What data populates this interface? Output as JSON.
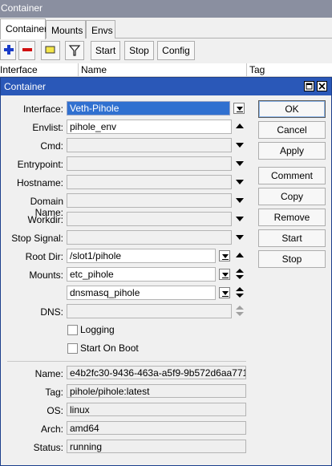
{
  "window": {
    "title": "Container"
  },
  "tabs": [
    "Container",
    "Mounts",
    "Envs"
  ],
  "toolbar": {
    "start": "Start",
    "stop": "Stop",
    "config": "Config"
  },
  "columns": {
    "interface": "Interface",
    "name": "Name",
    "tag": "Tag"
  },
  "dialog": {
    "title": "Container",
    "fields": {
      "interface": {
        "label": "Interface:",
        "value": "Veth-Pihole"
      },
      "envlist": {
        "label": "Envlist:",
        "value": "pihole_env"
      },
      "cmd": {
        "label": "Cmd:",
        "value": ""
      },
      "entrypoint": {
        "label": "Entrypoint:",
        "value": ""
      },
      "hostname": {
        "label": "Hostname:",
        "value": ""
      },
      "domain_name": {
        "label": "Domain Name:",
        "value": ""
      },
      "workdir": {
        "label": "Workdir:",
        "value": ""
      },
      "stop_signal": {
        "label": "Stop Signal:",
        "value": ""
      },
      "root_dir": {
        "label": "Root Dir:",
        "value": "/slot1/pihole"
      },
      "mounts": {
        "label": "Mounts:",
        "values": [
          "etc_pihole",
          "dnsmasq_pihole"
        ]
      },
      "dns": {
        "label": "DNS:",
        "value": ""
      }
    },
    "checkboxes": {
      "logging": {
        "label": "Logging",
        "checked": false
      },
      "start_on_boot": {
        "label": "Start On Boot",
        "checked": false
      }
    },
    "info": {
      "name": {
        "label": "Name:",
        "value": "e4b2fc30-9436-463a-a5f9-9b572d6aa771"
      },
      "tag": {
        "label": "Tag:",
        "value": "pihole/pihole:latest"
      },
      "os": {
        "label": "OS:",
        "value": "linux"
      },
      "arch": {
        "label": "Arch:",
        "value": "amd64"
      },
      "status": {
        "label": "Status:",
        "value": "running"
      }
    },
    "buttons": {
      "ok": "OK",
      "cancel": "Cancel",
      "apply": "Apply",
      "comment": "Comment",
      "copy": "Copy",
      "remove": "Remove",
      "start": "Start",
      "stop": "Stop"
    }
  },
  "colors": {
    "title_bar": "#2a58b8",
    "selection": "#3070d0",
    "bg_title": "#8a8fa0"
  }
}
